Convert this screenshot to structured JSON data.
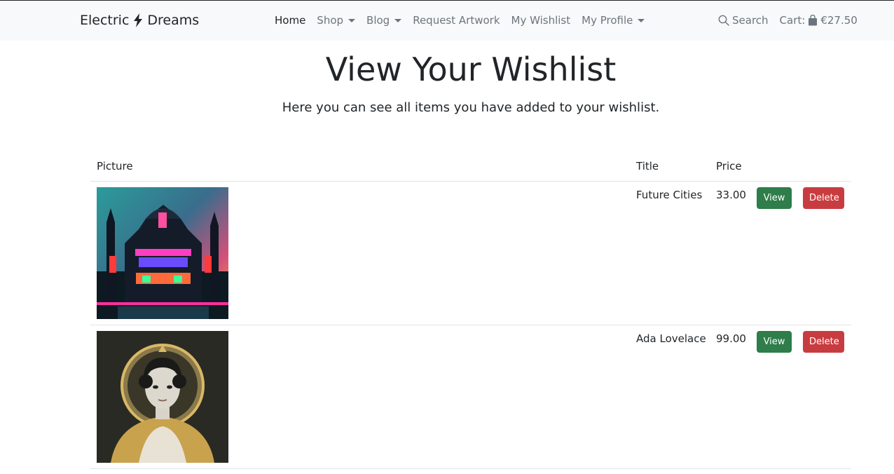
{
  "brand": {
    "left": "Electric",
    "right": "Dreams"
  },
  "nav": {
    "links": [
      {
        "label": "Home",
        "active": true,
        "dropdown": false
      },
      {
        "label": "Shop",
        "active": false,
        "dropdown": true
      },
      {
        "label": "Blog",
        "active": false,
        "dropdown": true
      },
      {
        "label": "Request Artwork",
        "active": false,
        "dropdown": false
      },
      {
        "label": "My Wishlist",
        "active": false,
        "dropdown": false
      },
      {
        "label": "My Profile",
        "active": false,
        "dropdown": true
      }
    ],
    "search_label": "Search",
    "cart_label": "Cart:",
    "cart_total": "€27.50"
  },
  "page": {
    "title": "View Your Wishlist",
    "subtitle": "Here you can see all items you have added to your wishlist."
  },
  "table": {
    "headers": {
      "picture": "Picture",
      "title": "Title",
      "price": "Price"
    },
    "rows": [
      {
        "title": "Future Cities",
        "price": "33.00",
        "view_label": "View",
        "delete_label": "Delete"
      },
      {
        "title": "Ada Lovelace",
        "price": "99.00",
        "view_label": "View",
        "delete_label": "Delete"
      }
    ]
  },
  "colors": {
    "view_button": "#2e7d4a",
    "delete_button": "#c83c40",
    "navbar_bg": "#f8f9fa"
  },
  "icons": {
    "brand": "lightning-bolt-icon",
    "search": "search-icon",
    "cart": "shopping-bag-icon"
  }
}
